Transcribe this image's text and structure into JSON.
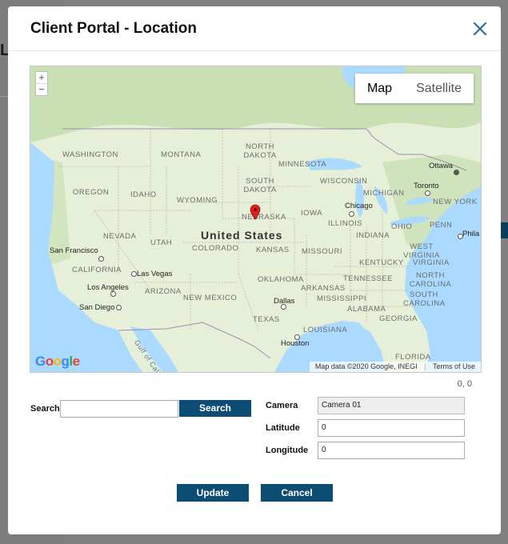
{
  "background": {
    "letter": "L"
  },
  "modal": {
    "title": "Client Portal - Location",
    "close_icon": "close-icon"
  },
  "map": {
    "map_type": {
      "map": "Map",
      "satellite": "Satellite",
      "selected": "Map"
    },
    "zoom": {
      "in": "+",
      "out": "−"
    },
    "country_label": "United States",
    "state_labels": [
      "WASHINGTON",
      "MONTANA",
      "NORTH DAKOTA",
      "MINNESOTA",
      "OREGON",
      "IDAHO",
      "WYOMING",
      "SOUTH DAKOTA",
      "WISCONSIN",
      "MICHIGAN",
      "NEBRASKA",
      "IOWA",
      "NEVADA",
      "UTAH",
      "COLORADO",
      "KANSAS",
      "ILLINOIS",
      "INDIANA",
      "OHIO",
      "PENN",
      "NEW YORK",
      "CALIFORNIA",
      "MISSOURI",
      "KENTUCKY",
      "WEST VIRGINIA",
      "VIRGINIA",
      "ARIZONA",
      "NEW MEXICO",
      "OKLAHOMA",
      "ARKANSAS",
      "TENNESSEE",
      "NORTH CAROLINA",
      "SOUTH CAROLINA",
      "MISSISSIPPI",
      "ALABAMA",
      "GEORGIA",
      "TEXAS",
      "LOUISIANA",
      "FLORIDA"
    ],
    "cities": [
      "Ottawa",
      "Toronto",
      "Chicago",
      "San Francisco",
      "Las Vegas",
      "Los Angeles",
      "San Diego",
      "Dallas",
      "Houston",
      "Phila"
    ],
    "water_label": "Gulf of California",
    "google_logo": "Google",
    "attribution": "Map data ©2020 Google, INEGI",
    "terms": "Terms of Use",
    "marker_icon": "map-pin-icon",
    "coords": "0, 0"
  },
  "form": {
    "search_label": "Search",
    "search_value": "",
    "search_button": "Search",
    "camera_label": "Camera",
    "camera_value": "Camera 01",
    "latitude_label": "Latitude",
    "latitude_value": "0",
    "longitude_label": "Longitude",
    "longitude_value": "0",
    "update_button": "Update",
    "cancel_button": "Cancel"
  },
  "colors": {
    "accent": "#0d4c73",
    "water": "#aadaff",
    "land": "#e8efd9",
    "marker": "#e11d1d"
  }
}
